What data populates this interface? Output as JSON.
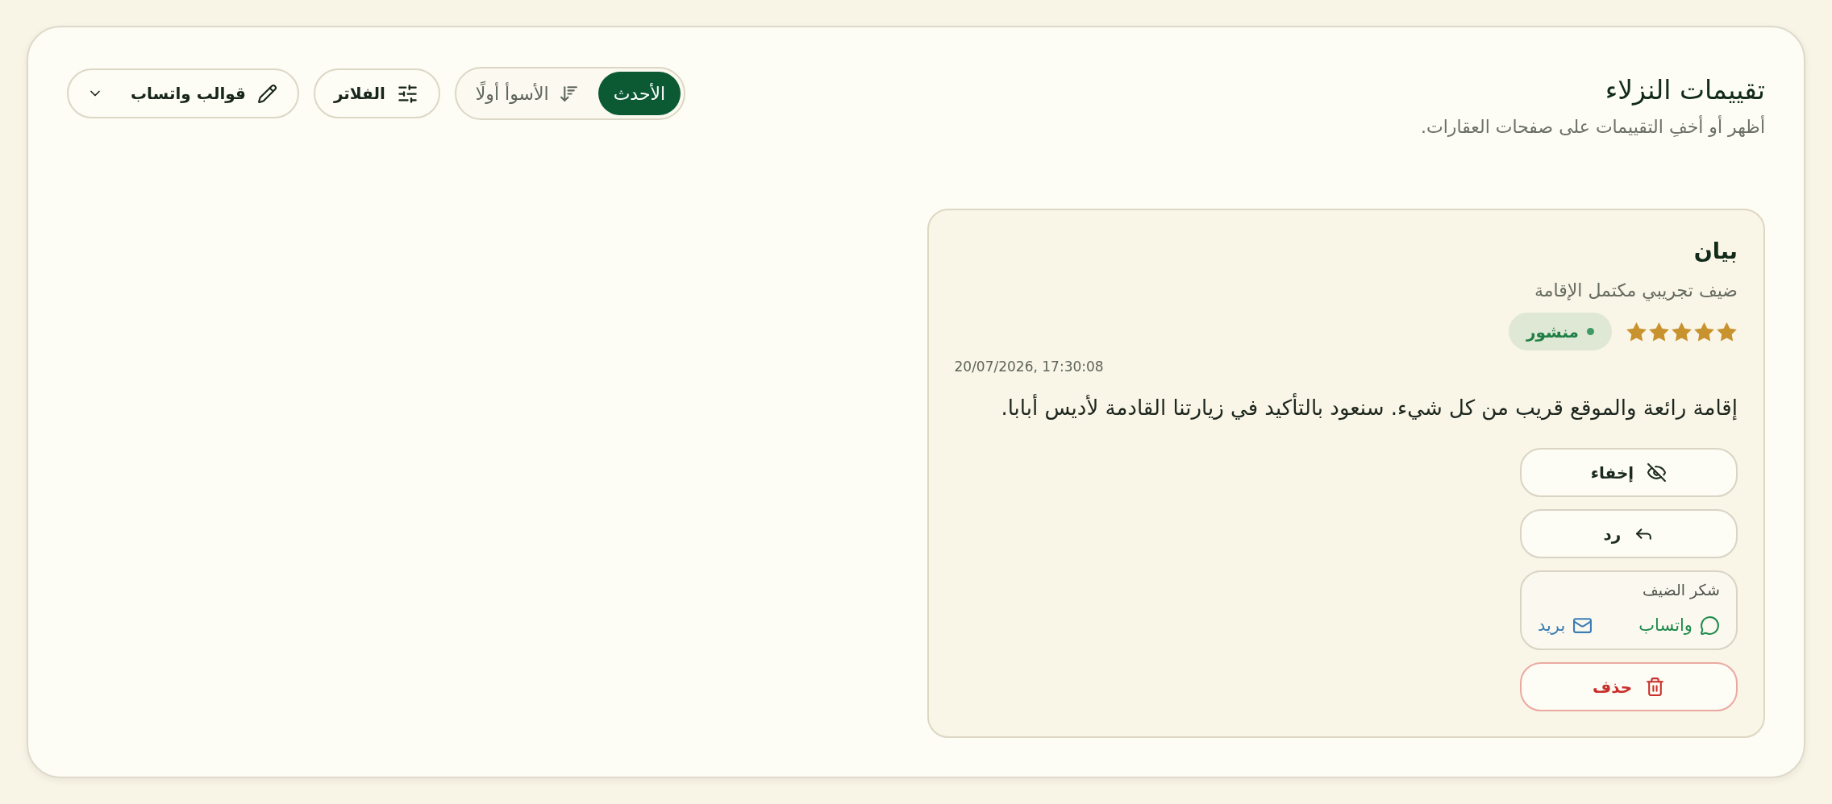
{
  "header": {
    "title": "تقييمات النزلاء",
    "subtitle": "أظهر أو أخفِ التقييمات على صفحات العقارات."
  },
  "toolbar": {
    "sort_options": [
      {
        "kind": "newest",
        "label": "الأحدث",
        "selected": true
      },
      {
        "kind": "worst",
        "label": "الأسوأ أولًا",
        "selected": false
      }
    ],
    "filters_button": "الفلاتر",
    "templates_button": "قوالب واتساب"
  },
  "reviews": [
    {
      "guest_name": "بيان",
      "guest_note": "ضيف تجريبي مكتمل الإقامة",
      "stars": 5,
      "status": {
        "label": "منشور",
        "published": true
      },
      "date": "20/07/2026, 17:30:08",
      "text": "إقامة رائعة والموقع قريب من كل شيء. سنعود بالتأكيد في زيارتنا القادمة لأديس أبابا.",
      "actions": [
        {
          "kind": "hide",
          "label": "إخفاء"
        },
        {
          "kind": "reply",
          "label": "رد"
        },
        {
          "kind": "thanks",
          "label": "شكر الضيف",
          "channels": [
            {
              "kind": "whatsapp",
              "label": "واتساب"
            },
            {
              "kind": "email",
              "label": "بريد"
            }
          ]
        },
        {
          "kind": "delete",
          "label": "حذف"
        }
      ]
    }
  ]
}
